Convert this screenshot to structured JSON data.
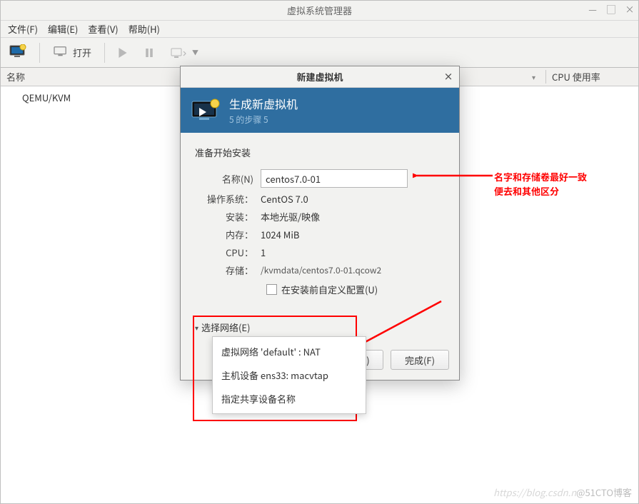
{
  "window": {
    "title": "虚拟系统管理器",
    "menus": {
      "file": "文件(F)",
      "edit": "编辑(E)",
      "view": "查看(V)",
      "help": "帮助(H)"
    },
    "toolbar": {
      "open": "打开"
    },
    "columns": {
      "name": "名称",
      "cpu": "CPU 使用率"
    },
    "connections": [
      {
        "label": "QEMU/KVM"
      }
    ]
  },
  "dialog": {
    "title": "新建虚拟机",
    "banner": {
      "heading": "生成新虚拟机",
      "step": "5 的步骤 5"
    },
    "section": "准备开始安装",
    "fields": {
      "nameLabel": "名称(N)",
      "nameValue": "centos7.0-01",
      "osLabel": "操作系统：",
      "osValue": "CentOS 7.0",
      "installLabel": "安装：",
      "installValue": "本地光驱/映像",
      "memLabel": "内存：",
      "memValue": "1024 MiB",
      "cpuLabel": "CPU：",
      "cpuValue": "1",
      "storageLabel": "存储：",
      "storageValue": "/kvmdata/centos7.0-01.qcow2",
      "customizeLabel": "在安装前自定义配置(U)"
    },
    "network": {
      "expander": "选择网络(E)",
      "options": [
        "虚拟网络 'default' : NAT",
        "主机设备 ens33: macvtap",
        "指定共享设备名称"
      ]
    },
    "buttons": {
      "back": "后退(B)",
      "finish": "完成(F)"
    }
  },
  "annotations": {
    "line1": "名字和存储卷最好一致",
    "line2": "便去和其他区分"
  },
  "watermark": {
    "faded": "https://blog.csdn.n",
    "main": "@51CTO博客"
  }
}
